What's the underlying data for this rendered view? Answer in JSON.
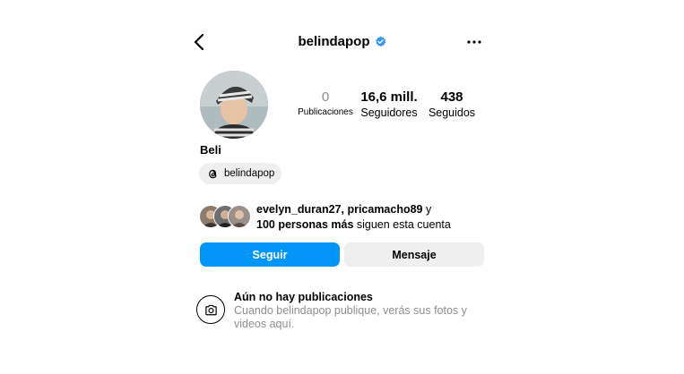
{
  "header": {
    "username": "belindapop",
    "verified": true,
    "back_icon": "chevron-left-icon",
    "more_icon": "more-horizontal-icon",
    "verified_color": "#3897f0"
  },
  "profile": {
    "display_name": "Beli",
    "stats": {
      "posts_value": "0",
      "posts_label": "Publicaciones",
      "followers_value": "16,6 mill.",
      "followers_label": "Seguidores",
      "following_value": "438",
      "following_label": "Seguidos"
    },
    "threads_handle": "belindapop"
  },
  "mutual": {
    "users": "evelyn_duran27, pricamacho89",
    "connector": " y",
    "more": "100 personas más",
    "suffix": " siguen esta cuenta"
  },
  "actions": {
    "follow_label": "Seguir",
    "message_label": "Mensaje",
    "follow_color": "#0095f6"
  },
  "empty_state": {
    "title": "Aún no hay publicaciones",
    "description": "Cuando belindapop publique, verás sus fotos y videos aquí.",
    "icon": "camera-icon"
  }
}
